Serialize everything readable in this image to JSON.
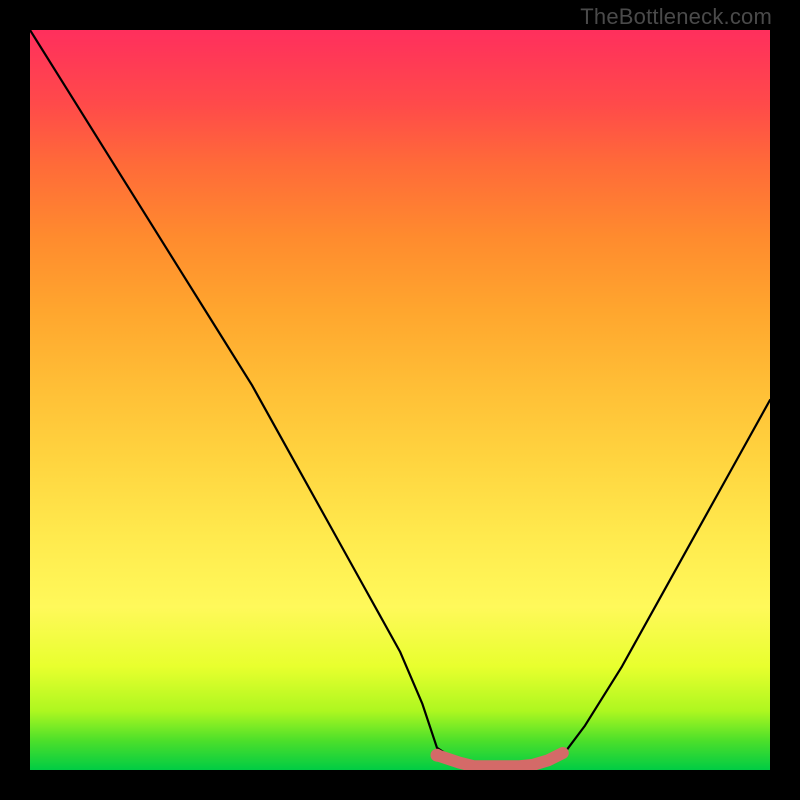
{
  "watermark": "TheBottleneck.com",
  "chart_data": {
    "type": "line",
    "title": "",
    "xlabel": "",
    "ylabel": "",
    "xlim": [
      0,
      100
    ],
    "ylim": [
      0,
      100
    ],
    "grid": false,
    "series": [
      {
        "name": "bottleneck-curve",
        "color": "#000000",
        "x": [
          0,
          5,
          10,
          15,
          20,
          25,
          30,
          35,
          40,
          45,
          50,
          53,
          55,
          58,
          62,
          66,
          70,
          72,
          75,
          80,
          85,
          90,
          95,
          100
        ],
        "values": [
          100,
          92,
          84,
          76,
          68,
          60,
          52,
          43,
          34,
          25,
          16,
          9,
          3,
          1,
          0,
          0,
          1,
          2,
          6,
          14,
          23,
          32,
          41,
          50
        ]
      },
      {
        "name": "highlight-band",
        "color": "#d46a68",
        "x": [
          55,
          58,
          60,
          62,
          64,
          66,
          68,
          70,
          72
        ],
        "values": [
          2,
          1,
          0.5,
          0.5,
          0.5,
          0.5,
          0.7,
          1.3,
          2.3
        ]
      }
    ],
    "markers": [
      {
        "name": "highlight-start-dot",
        "x": 55,
        "y": 2,
        "color": "#d46a68"
      }
    ],
    "background_gradient": {
      "direction": "vertical",
      "stops": [
        {
          "pos": 0,
          "color": "#00cc44"
        },
        {
          "pos": 0.1,
          "color": "#aef720"
        },
        {
          "pos": 0.25,
          "color": "#fff95a"
        },
        {
          "pos": 0.5,
          "color": "#ffbe36"
        },
        {
          "pos": 0.75,
          "color": "#ff8b2e"
        },
        {
          "pos": 1.0,
          "color": "#ff2f5d"
        }
      ]
    }
  }
}
